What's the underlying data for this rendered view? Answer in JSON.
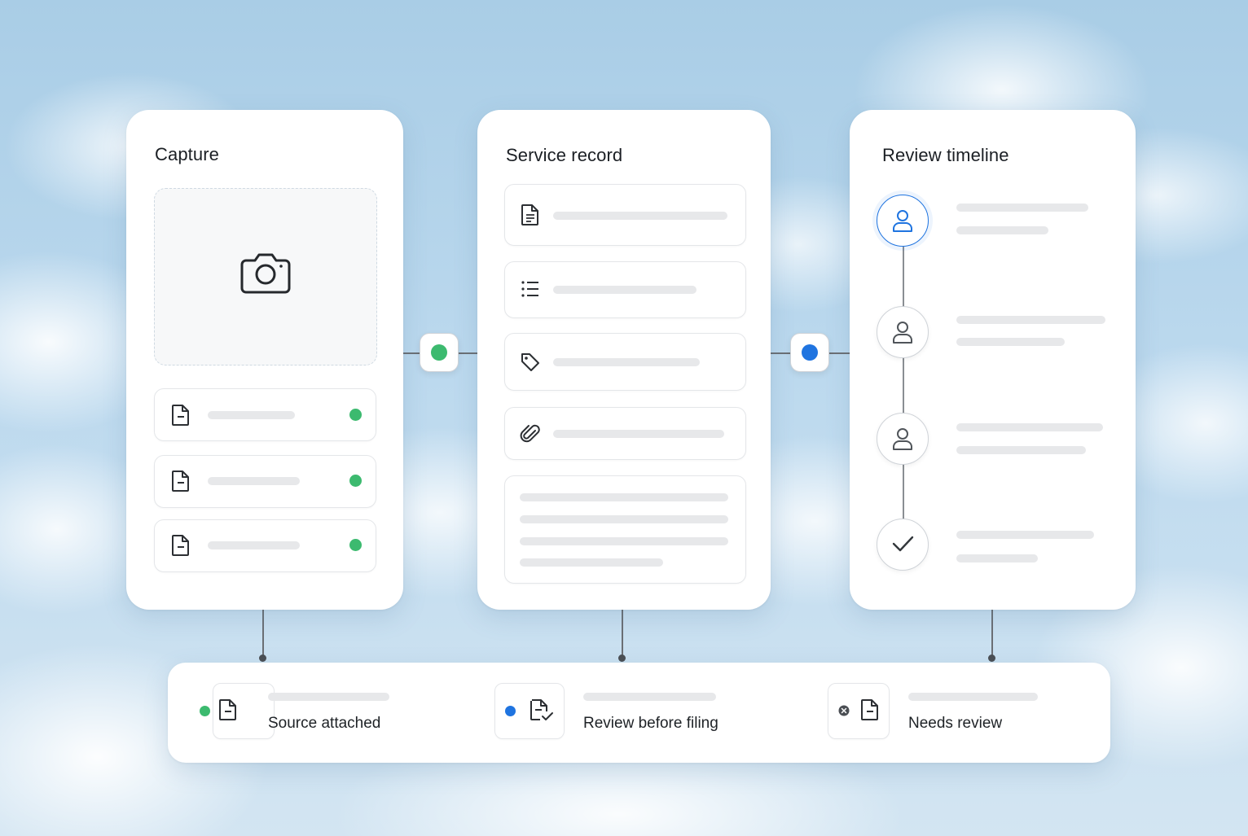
{
  "cards": {
    "capture": {
      "title": "Capture"
    },
    "service_record": {
      "title": "Service record"
    },
    "review_timeline": {
      "title": "Review timeline"
    }
  },
  "connectors": {
    "left_status_color": "#3cba6f",
    "right_status_color": "#1f74e0"
  },
  "capture_files": [
    {
      "icon": "document-icon",
      "status_color": "#3cba6f"
    },
    {
      "icon": "document-icon",
      "status_color": "#3cba6f"
    },
    {
      "icon": "document-icon",
      "status_color": "#3cba6f"
    }
  ],
  "service_fields": [
    {
      "icon": "document-icon"
    },
    {
      "icon": "list-icon"
    },
    {
      "icon": "tag-icon"
    },
    {
      "icon": "paperclip-icon"
    }
  ],
  "timeline_steps": [
    {
      "icon": "user-icon",
      "active": true
    },
    {
      "icon": "user-icon",
      "active": false
    },
    {
      "icon": "user-icon",
      "active": false
    },
    {
      "icon": "checkmark-icon",
      "active": false
    }
  ],
  "legend": {
    "items": [
      {
        "label": "Source attached",
        "status": "green-dot",
        "color": "#3cba6f",
        "icon": "document-icon"
      },
      {
        "label": "Review before filing",
        "status": "blue-dot",
        "color": "#1f74e0",
        "icon": "document-check-icon"
      },
      {
        "label": "Needs review",
        "status": "x-circle",
        "color": "#5b5f64",
        "icon": "document-icon"
      }
    ]
  },
  "colors": {
    "accent_blue": "#1f74e0",
    "success_green": "#3cba6f",
    "placeholder_gray": "#e7e8ea"
  }
}
